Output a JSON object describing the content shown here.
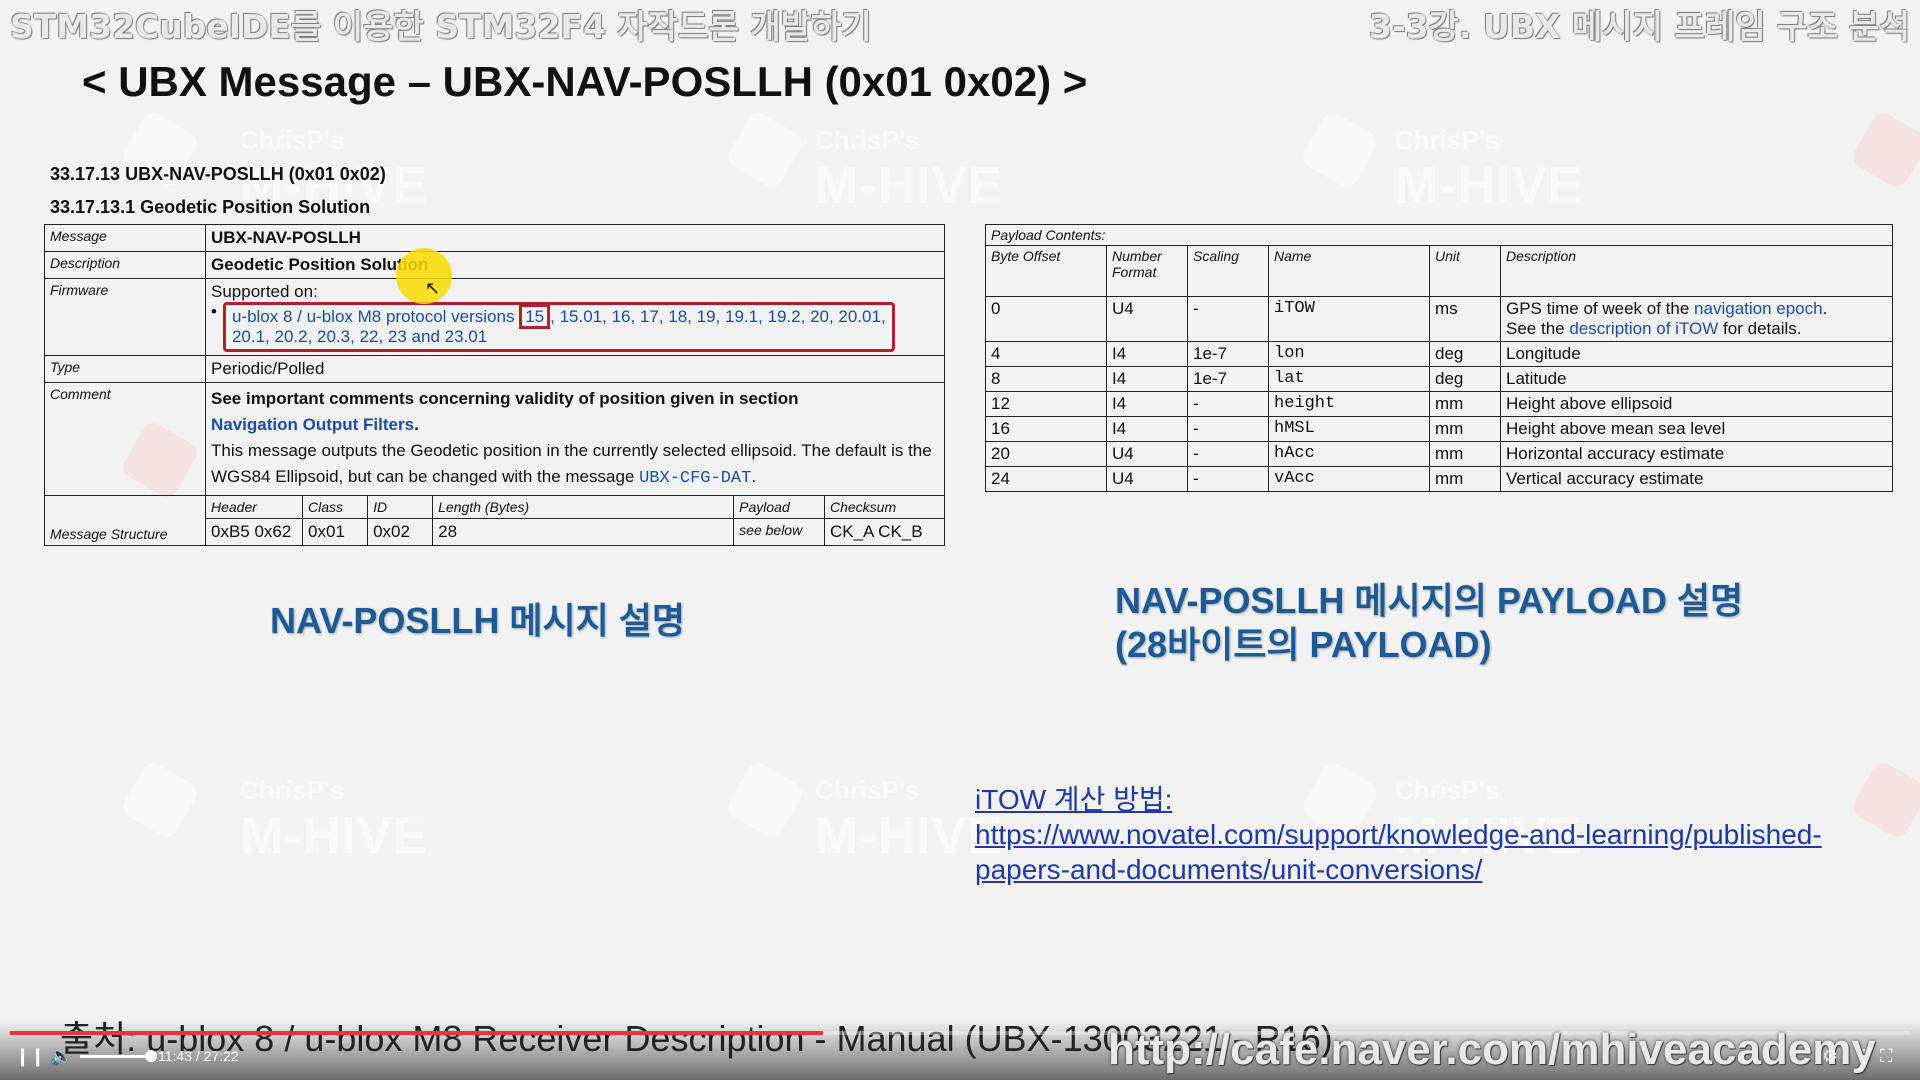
{
  "header": {
    "left_title": "STM32CubeIDE를 이용한 STM32F4 자작드론 개발하기",
    "right_title": "3-3강. UBX 메시지 프레임 구조 분석"
  },
  "slide_title": "< UBX Message – UBX-NAV-POSLLH (0x01 0x02) >",
  "watermark": {
    "small": "ChrisP's",
    "big": "M-HIVE"
  },
  "doc": {
    "sec1": "33.17.13 UBX-NAV-POSLLH (0x01 0x02)",
    "sec2": "33.17.13.1 Geodetic Position Solution",
    "rows": {
      "message_label": "Message",
      "message_value": "UBX-NAV-POSLLH",
      "description_label": "Description",
      "description_value": "Geodetic Position Solution",
      "firmware_label": "Firmware",
      "firmware_supported": "Supported on:",
      "firmware_bullet": "•",
      "firmware_versions_a": "u-blox 8 / u-blox M8 protocol versions",
      "firmware_15": "15",
      "firmware_versions_b": ", 15.01, 16, 17, 18, 19, 19.1, 19.2, 20, 20.01,",
      "firmware_versions_c": "20.1, 20.2, 20.3, 22, 23 and 23.01",
      "type_label": "Type",
      "type_value": "Periodic/Polled",
      "comment_label": "Comment",
      "comment_bold": "See important comments concerning validity of position given in section",
      "comment_link": "Navigation Output Filters",
      "comment_link_end": ".",
      "comment_text": "This message outputs the Geodetic position in the currently selected ellipsoid. The default is the WGS84 Ellipsoid, but can be changed with the message",
      "comment_msg": "UBX-CFG-DAT",
      "comment_end": ".",
      "struct_label": "Message Structure",
      "struct_headers": [
        "Header",
        "Class",
        "ID",
        "Length (Bytes)",
        "Payload",
        "Checksum"
      ],
      "struct_values": [
        "0xB5 0x62",
        "0x01",
        "0x02",
        "28",
        "see below",
        "CK_A CK_B"
      ]
    }
  },
  "payload": {
    "contents_label": "Payload Contents:",
    "headers": [
      "Byte Offset",
      "Number Format",
      "Scaling",
      "Name",
      "Unit",
      "Description"
    ],
    "rows": [
      [
        "0",
        "U4",
        "-",
        "iTOW",
        "ms",
        "GPS time of week of the",
        "navigation epoch",
        ".",
        "See the",
        "description of iTOW",
        "for details."
      ],
      [
        "4",
        "I4",
        "1e-7",
        "lon",
        "deg",
        "Longitude"
      ],
      [
        "8",
        "I4",
        "1e-7",
        "lat",
        "deg",
        "Latitude"
      ],
      [
        "12",
        "I4",
        "-",
        "height",
        "mm",
        "Height above ellipsoid"
      ],
      [
        "16",
        "I4",
        "-",
        "hMSL",
        "mm",
        "Height above mean sea level"
      ],
      [
        "20",
        "U4",
        "-",
        "hAcc",
        "mm",
        "Horizontal accuracy estimate"
      ],
      [
        "24",
        "U4",
        "-",
        "vAcc",
        "mm",
        "Vertical accuracy estimate"
      ]
    ]
  },
  "captions": {
    "left": "NAV-POSLLH 메시지 설명",
    "right_line1": "NAV-POSLLH 메시지의 PAYLOAD 설명",
    "right_line2": "(28바이트의 PAYLOAD)"
  },
  "link": {
    "label": "iTOW 계산 방법:",
    "url_line1": "https://www.novatel.com/support/knowledge-and-learning/published-",
    "url_line2": "papers-and-documents/unit-conversions/"
  },
  "footer": {
    "source": "출처: u-blox 8 / u-blox M8 Receiver Description - Manual (UBX-13003221 - R16)",
    "url_watermark": "http://cafe.naver.com/mhiveacademy"
  },
  "player": {
    "time": "11:43 / 27:22",
    "progress_fraction": 0.428
  }
}
